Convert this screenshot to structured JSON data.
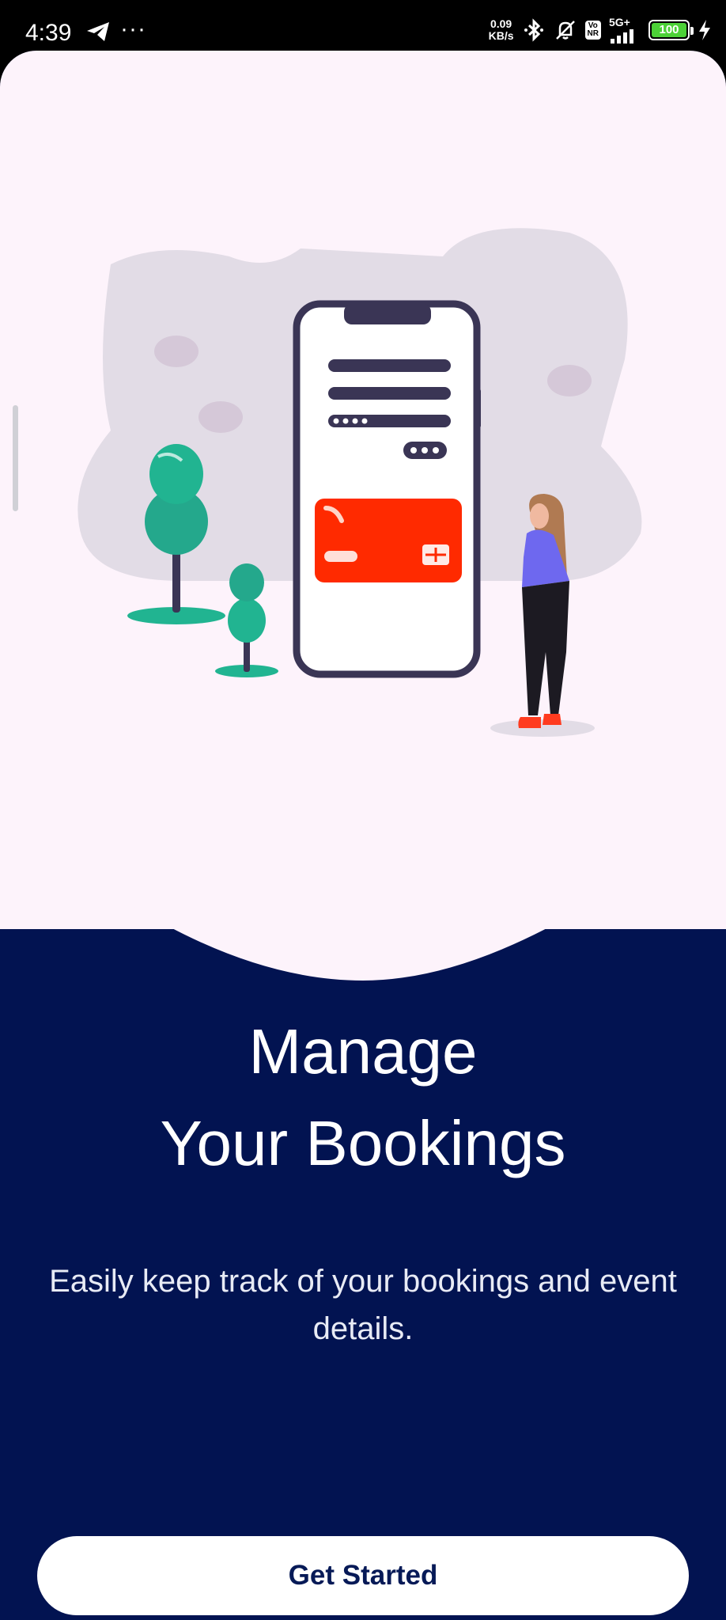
{
  "status_bar": {
    "time": "4:39",
    "dots": "···",
    "speed_value": "0.09",
    "speed_unit": "KB/s",
    "vonr_top": "Vo",
    "vonr_bottom": "NR",
    "network": "5G+",
    "battery_level": "100",
    "battery_fraction": 1.0,
    "icons": [
      "telegram-icon",
      "bluetooth-icon",
      "muted-bell-icon",
      "signal-icon",
      "battery-icon",
      "charging-icon"
    ]
  },
  "onboarding": {
    "title_line1": "Manage",
    "title_line2": "Your Bookings",
    "subtitle": "Easily keep track of your bookings and event details.",
    "cta_label": "Get Started"
  },
  "colors": {
    "background_dark": "#021351",
    "hero_background": "#fdf3fb",
    "card_red": "#ff2a00",
    "tree_green": "#21b491",
    "person_top": "#6e68ef"
  }
}
